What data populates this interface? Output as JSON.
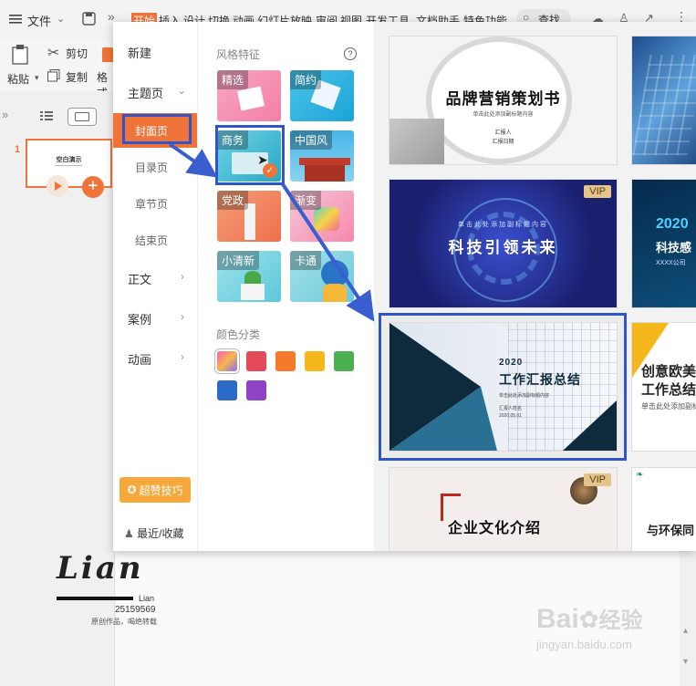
{
  "toolbar": {
    "menu_label": "文件",
    "tabs": [
      "开始",
      "插入",
      "设计",
      "切换",
      "动画",
      "幻灯片放映",
      "审阅",
      "视图",
      "开发工具",
      "文档助手",
      "特色功能"
    ],
    "search_label": "查找"
  },
  "ribbon": {
    "cut": "剪切",
    "paste": "粘贴",
    "copy": "复制",
    "format": "格式"
  },
  "slides": {
    "thumb_number": "1",
    "thumb_title": "空白演示"
  },
  "nav": {
    "new": "新建",
    "theme": "主题页",
    "cover": "封面页",
    "toc": "目录页",
    "chapter": "章节页",
    "ending": "结束页",
    "body": "正文",
    "cases": "案例",
    "animation": "动画",
    "tips": "超赞技巧",
    "recent": "最近/收藏"
  },
  "styles": {
    "title": "风格特征",
    "help": "?",
    "items": [
      "精选",
      "简约",
      "商务",
      "中国风",
      "党政",
      "渐变",
      "小清新",
      "卡通"
    ]
  },
  "colors": {
    "title": "颜色分类",
    "swatches": [
      "#e44b5a",
      "#f57a2b",
      "#f6b71c",
      "#4caf50",
      "#2d6bc9",
      "#8e44c4"
    ]
  },
  "templates": {
    "t1_title": "品牌营销策划书",
    "t1_sub": "单击此处添加副标题内容",
    "t1_rep1": "汇报人",
    "t1_rep2": "汇报日期",
    "t2_title": "科技引领未来",
    "t2_top": "单击此处添加副标题内容",
    "vip": "VIP",
    "t3_year": "2020",
    "t3_title": "工作汇报总结",
    "t3_sub": "单击此处添加副标题内容",
    "t3_rep": "汇报人姓名",
    "t3_date": "2020.05.01",
    "t4_year": "2020",
    "t4_title": "科技感",
    "t4_company": "XXXX公司",
    "t5_title": "创意欧美",
    "t5_title2": "工作总结",
    "t5_sub": "单击此处添加副标",
    "t6_title": "企业文化介绍",
    "t7_title": "与环保同"
  },
  "canvas": {
    "logo": "Lian",
    "logo_small": "Lian",
    "number": "25159569",
    "caption": "原创作品，喝绝转载"
  },
  "watermark": {
    "brand": "Bai",
    "brand2": "经验",
    "url": "jingyan.baidu.com"
  }
}
